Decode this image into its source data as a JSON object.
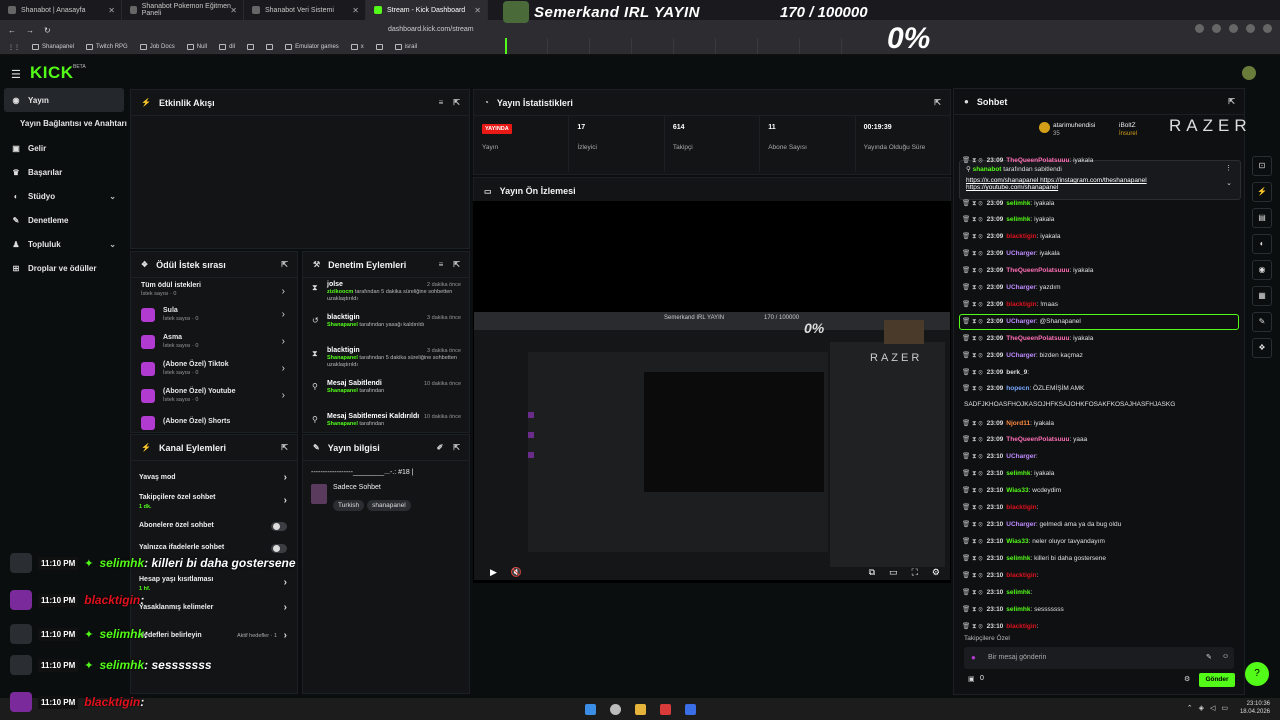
{
  "browser": {
    "tabs": [
      {
        "label": "Shanabot | Anasayfa",
        "active": false
      },
      {
        "label": "Shanabot Pokemon Eğitmen Paneli",
        "active": false
      },
      {
        "label": "Shanabot Veri Sistemi",
        "active": false
      },
      {
        "label": "Stream - Kick Dashboard",
        "active": true
      }
    ],
    "url": "dashboard.kick.com/stream",
    "bookmarks": [
      "Shanapanel",
      "Twitch RPG",
      "Job Docs",
      "Null",
      "dil",
      "",
      "",
      "Emulator games",
      "x",
      "",
      "israil"
    ]
  },
  "overlay": {
    "title": "Semerkand IRL YAYIN",
    "counter": "170 / 100000",
    "percent": "0%",
    "progress": 0.0017
  },
  "kick": {
    "logo": "KICK",
    "logo_sup": "BETA"
  },
  "sidebar": {
    "items": [
      {
        "label": "Yayın",
        "icon": "broadcast-icon",
        "active": true
      },
      {
        "label": "Yayın Bağlantısı ve Anahtarı",
        "sub": true
      },
      {
        "label": "Gelir",
        "icon": "money-icon"
      },
      {
        "label": "Başarılar",
        "icon": "trophy-icon"
      },
      {
        "label": "Stüdyo",
        "icon": "studio-icon",
        "chevron": true
      },
      {
        "label": "Denetleme",
        "icon": "wrench-icon"
      },
      {
        "label": "Topluluk",
        "icon": "community-icon",
        "chevron": true
      },
      {
        "label": "Droplar ve ödüller",
        "icon": "gift-icon"
      }
    ]
  },
  "activity": {
    "title": "Etkinlik Akışı"
  },
  "stats": {
    "title": "Yayın İstatistikleri",
    "live_badge": "YAYINDA",
    "live_label": "Yayın",
    "items": [
      {
        "value": "17",
        "label": "İzleyici"
      },
      {
        "value": "614",
        "label": "Takipçi"
      },
      {
        "value": "11",
        "label": "Abone Sayısı"
      },
      {
        "value": "00:19:39",
        "label": "Yayında Olduğu Süre"
      }
    ]
  },
  "preview": {
    "title": "Yayın Ön İzlemesi",
    "mini_title": "Semerkand IRL YAYIN",
    "mini_counter": "170 / 100000",
    "mini_percent": "0%",
    "mini_brand": "RAZER"
  },
  "rewards": {
    "title": "Ödül İstek sırası",
    "all_label": "Tüm ödül istekleri",
    "all_count": "İstek sayısı · 0",
    "items": [
      {
        "name": "Sula",
        "count": "İstek sayısı · 0"
      },
      {
        "name": "Asma",
        "count": "İstek sayısı · 0"
      },
      {
        "name": "(Abone Özel) Tiktok",
        "count": "İstek sayısı · 0"
      },
      {
        "name": "(Abone Özel) Youtube",
        "count": "İstek sayısı · 0"
      },
      {
        "name": "(Abone Özel) Shorts",
        "count": ""
      }
    ]
  },
  "moderation": {
    "title": "Denetim Eylemleri",
    "items": [
      {
        "user": "jolse",
        "time": "2 dakika önce",
        "actor": "zizikoocm",
        "text": " tarafından 5 dakika süreliğine sohbetten uzaklaştırıldı"
      },
      {
        "user": "blacktigin",
        "time": "3 dakika önce",
        "actor": "Shanapanel",
        "text": " tarafından yasağı kaldırıldı"
      },
      {
        "user": "blacktigin",
        "time": "3 dakika önce",
        "actor": "Shanapanel",
        "text": " tarafından 5 dakika süreliğine sohbetten uzaklaştırıldı"
      },
      {
        "user": "Mesaj Sabitlendi",
        "time": "10 dakika önce",
        "actor": "Shanapanel",
        "text": " tarafından"
      },
      {
        "user": "Mesaj Sabitlemesi Kaldırıldı",
        "time": "10 dakika önce",
        "actor": "Shanapanel",
        "text": " tarafından"
      }
    ]
  },
  "channel": {
    "title": "Kanal Eylemleri",
    "items": [
      {
        "label": "Yavaş mod",
        "type": "chevron",
        "sub": ""
      },
      {
        "label": "Takipçilere özel sohbet",
        "type": "chevron",
        "sub": "1 dk."
      },
      {
        "label": "Abonelere özel sohbet",
        "type": "toggle",
        "sub": ""
      },
      {
        "label": "Yalnızca ifadelerle sohbet",
        "type": "toggle",
        "sub": ""
      },
      {
        "label": "Hesap yaşı kısıtlaması",
        "type": "chevron",
        "sub": "1 hf."
      },
      {
        "label": "Yasaklanmış kelimeler",
        "type": "chevron",
        "sub": ""
      },
      {
        "label": "Hedefleri belirleyin",
        "type": "chevron",
        "sub": "",
        "badge": "Aktif hedefler · 1"
      }
    ]
  },
  "info": {
    "title": "Yayın bilgisi",
    "stream_title": "------------------________...-.: #18 |",
    "category": "Sadece Sohbet",
    "tags": [
      "Turkish",
      "shanapanel"
    ]
  },
  "chat": {
    "title": "Sohbet",
    "top_user": "atarimuhendisi",
    "top_points": "35",
    "top_user2": "iBoltZ",
    "top_user2_sub": "İnsurel",
    "brand": "RAZER",
    "pinned_by": "shanabot",
    "pinned_label": "tarafından sabitlendi",
    "pinned_text1": "https://x.com/shanapanel https://instagram.com/theshanapanel",
    "pinned_text2": "https://youtube.com/shanapanel",
    "messages": [
      {
        "time": "23:09",
        "user": "TheQueenPolatsuuu",
        "text": ": iyakala",
        "color": "#ff6fb5"
      },
      {
        "time": "23:09",
        "user": "selimhk",
        "text": ": iyakala",
        "color": "#53fc18"
      },
      {
        "time": "23:09",
        "user": "selimhk",
        "text": ": iyakala",
        "color": "#53fc18"
      },
      {
        "time": "23:09",
        "user": "blacktigin",
        "text": ": iyakala",
        "color": "#e0111c"
      },
      {
        "time": "23:09",
        "user": "UCharger",
        "text": ": iyakala",
        "color": "#c08cff"
      },
      {
        "time": "23:09",
        "user": "TheQueenPolatsuuu",
        "text": ": iyakala",
        "color": "#ff6fb5"
      },
      {
        "time": "23:09",
        "user": "UCharger",
        "text": ": yazdım",
        "color": "#c08cff"
      },
      {
        "time": "23:09",
        "user": "blacktigin",
        "text": ": !maas",
        "color": "#e0111c"
      },
      {
        "time": "23:09",
        "user": "UCharger",
        "text": ": @Shanapanel",
        "color": "#c08cff"
      },
      {
        "time": "23:09",
        "user": "TheQueenPolatsuuu",
        "text": ": iyakala",
        "color": "#ff6fb5"
      },
      {
        "time": "23:09",
        "user": "UCharger",
        "text": ": bizden kaçmaz",
        "color": "#c08cff"
      },
      {
        "time": "23:09",
        "user": "berk_9",
        "text": ":",
        "color": "#dddddd"
      },
      {
        "time": "23:09",
        "user": "hopecn",
        "text": ": ÖZLEMİŞİM AMK",
        "color": "#7aa7ff"
      },
      {
        "time": "",
        "user": "",
        "text": "SADFJKHOASFHOJKASOJHFKSAJOHKFOSAKFKOSAJHASFHJASKG",
        "color": "#dddddd"
      },
      {
        "time": "23:09",
        "user": "Njord11",
        "text": ": iyakala",
        "color": "#ff8a3d"
      },
      {
        "time": "23:09",
        "user": "TheQueenPolatsuuu",
        "text": ": yaaa",
        "color": "#ff6fb5"
      },
      {
        "time": "23:10",
        "user": "UCharger",
        "text": ":",
        "color": "#c08cff"
      },
      {
        "time": "23:10",
        "user": "selimhk",
        "text": ": iyakala",
        "color": "#53fc18"
      },
      {
        "time": "23:10",
        "user": "Wias33",
        "text": ": wcdeydim",
        "color": "#53fc18"
      },
      {
        "time": "23:10",
        "user": "blacktigin",
        "text": ":",
        "color": "#e0111c"
      },
      {
        "time": "23:10",
        "user": "UCharger",
        "text": ": gelmedi ama ya da bug oldu",
        "color": "#c08cff"
      },
      {
        "time": "23:10",
        "user": "Wias33",
        "text": ": neler oluyor tavyandayım",
        "color": "#53fc18"
      },
      {
        "time": "23:10",
        "user": "selimhk",
        "text": ": killeri bi daha gostersene",
        "color": "#53fc18"
      },
      {
        "time": "23:10",
        "user": "blacktigin",
        "text": ":",
        "color": "#e0111c"
      },
      {
        "time": "23:10",
        "user": "selimhk",
        "text": ":",
        "color": "#53fc18"
      },
      {
        "time": "23:10",
        "user": "selimhk",
        "text": ": sesssssss",
        "color": "#53fc18"
      },
      {
        "time": "23:10",
        "user": "blacktigin",
        "text": ":",
        "color": "#e0111c"
      }
    ],
    "followers_only": "Takipçilere Özel",
    "placeholder": "Bir mesaj gönderin",
    "counter": "0",
    "send": "Gönder"
  },
  "overlay_chat": [
    {
      "time": "11:10 PM",
      "user": "selimhk",
      "text": ": killeri bi daha gostersene",
      "color": "green"
    },
    {
      "time": "11:10 PM",
      "user": "blacktigin",
      "text": ":",
      "color": "red"
    },
    {
      "time": "11:10 PM",
      "user": "selimhk",
      "text": ":",
      "color": "green"
    },
    {
      "time": "11:10 PM",
      "user": "selimhk",
      "text": ": sesssssss",
      "color": "green"
    },
    {
      "time": "11:10 PM",
      "user": "blacktigin",
      "text": ":",
      "color": "red"
    }
  ],
  "taskbar": {
    "time": "23:10:36",
    "date": "18.04.2026"
  }
}
